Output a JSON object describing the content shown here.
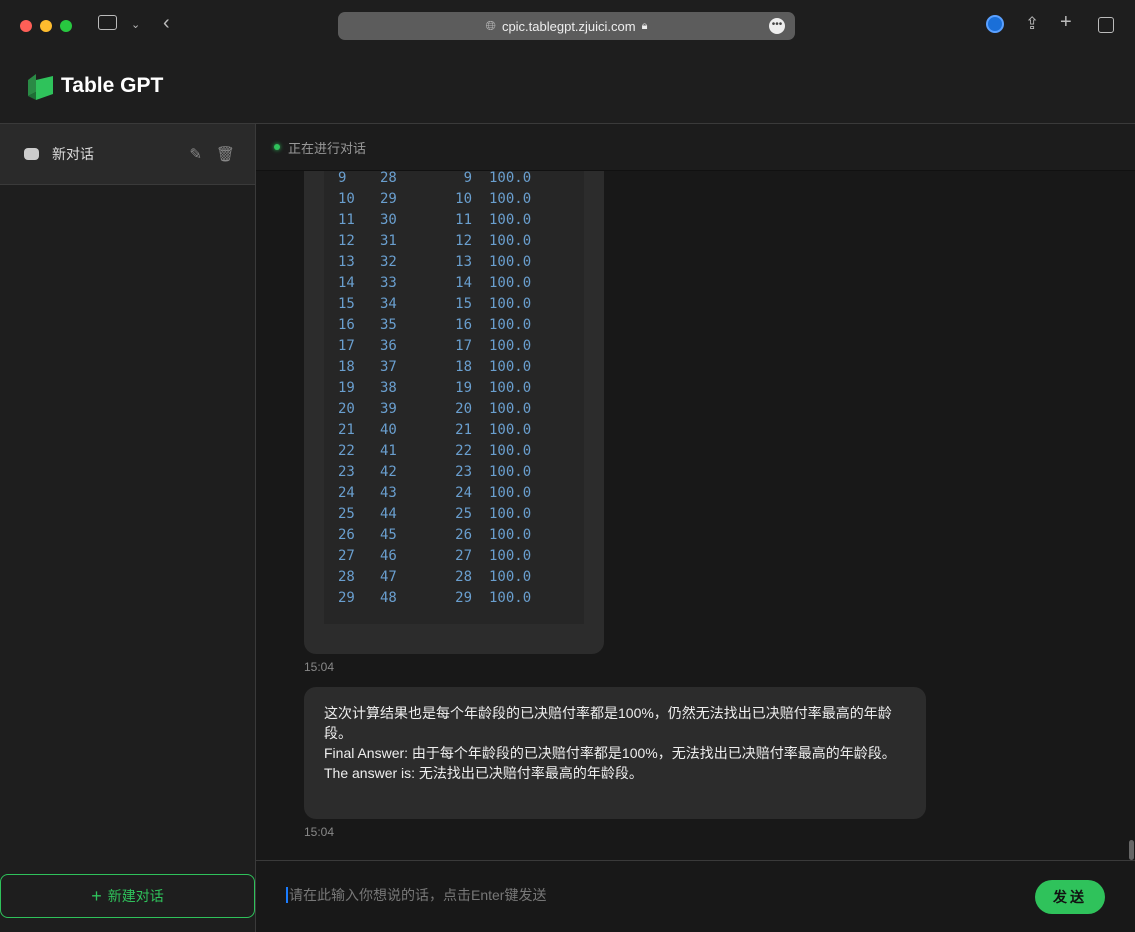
{
  "browser": {
    "url": "cpic.tablegpt.zjuici.com"
  },
  "app": {
    "name": "Table GPT",
    "brand_color": "#2fc25b"
  },
  "sidebar": {
    "conversations": [
      {
        "title": "新对话"
      }
    ],
    "new_chat_label": "新建对话"
  },
  "chat": {
    "status": "正在进行对话",
    "code_rows": [
      [
        "9",
        "28",
        "9",
        "100.0"
      ],
      [
        "10",
        "29",
        "10",
        "100.0"
      ],
      [
        "11",
        "30",
        "11",
        "100.0"
      ],
      [
        "12",
        "31",
        "12",
        "100.0"
      ],
      [
        "13",
        "32",
        "13",
        "100.0"
      ],
      [
        "14",
        "33",
        "14",
        "100.0"
      ],
      [
        "15",
        "34",
        "15",
        "100.0"
      ],
      [
        "16",
        "35",
        "16",
        "100.0"
      ],
      [
        "17",
        "36",
        "17",
        "100.0"
      ],
      [
        "18",
        "37",
        "18",
        "100.0"
      ],
      [
        "19",
        "38",
        "19",
        "100.0"
      ],
      [
        "20",
        "39",
        "20",
        "100.0"
      ],
      [
        "21",
        "40",
        "21",
        "100.0"
      ],
      [
        "22",
        "41",
        "22",
        "100.0"
      ],
      [
        "23",
        "42",
        "23",
        "100.0"
      ],
      [
        "24",
        "43",
        "24",
        "100.0"
      ],
      [
        "25",
        "44",
        "25",
        "100.0"
      ],
      [
        "26",
        "45",
        "26",
        "100.0"
      ],
      [
        "27",
        "46",
        "27",
        "100.0"
      ],
      [
        "28",
        "47",
        "28",
        "100.0"
      ],
      [
        "29",
        "48",
        "29",
        "100.0"
      ]
    ],
    "messages": [
      {
        "time": "15:04"
      },
      {
        "lines": [
          "这次计算结果也是每个年龄段的已决赔付率都是100%，仍然无法找出已决赔付率最高的年龄段。",
          "Final Answer: 由于每个年龄段的已决赔付率都是100%，无法找出已决赔付率最高的年龄段。",
          "The answer is: 无法找出已决赔付率最高的年龄段。"
        ],
        "time": "15:04"
      }
    ],
    "input_placeholder": "请在此输入你想说的话，点击Enter键发送",
    "send_label": "发送"
  }
}
